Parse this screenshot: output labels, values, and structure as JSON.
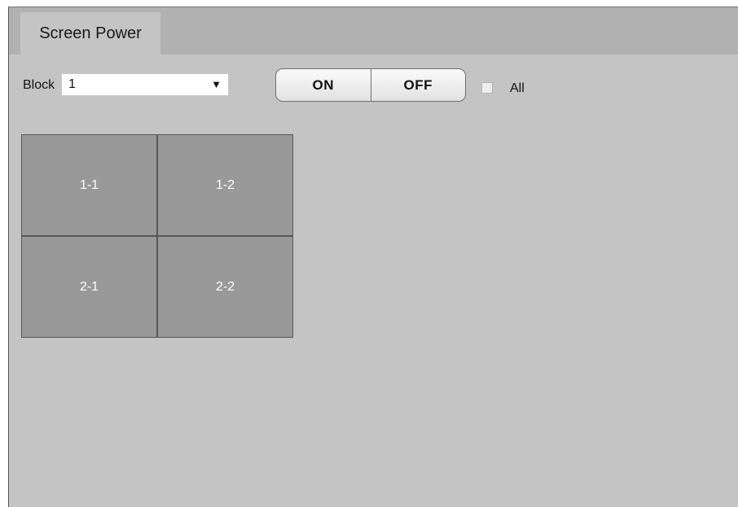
{
  "tab": {
    "label": "Screen Power"
  },
  "block": {
    "label": "Block",
    "selected": "1"
  },
  "power_buttons": {
    "on_label": "ON",
    "off_label": "OFF"
  },
  "all": {
    "label": "All",
    "checked": false
  },
  "grid": {
    "cells": [
      "1-1",
      "1-2",
      "2-1",
      "2-2"
    ]
  },
  "colors": {
    "panel_bg": "#c4c4c4",
    "tabbar_bg": "#b1b1b1",
    "cell_bg": "#999999"
  }
}
